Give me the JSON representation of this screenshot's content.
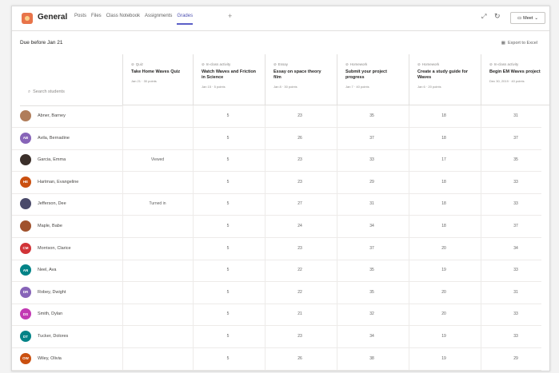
{
  "header": {
    "channel": "General",
    "tabs": [
      "Posts",
      "Files",
      "Class Notebook",
      "Assignments",
      "Grades"
    ],
    "active_tab": "Grades",
    "add_tab": "+",
    "meet_label": "Meet"
  },
  "toolbar": {
    "due_label": "Due before Jan 21",
    "export_label": "Export to Excel"
  },
  "search": {
    "placeholder": "Search students"
  },
  "columns": [
    {
      "type": "Quiz",
      "title": "Take Home Waves Quiz",
      "meta": "Jan 21 · 30 points"
    },
    {
      "type": "In-class activity",
      "title": "Watch Waves and Friction in Science",
      "meta": "Jan 15 · 5 points"
    },
    {
      "type": "Essay",
      "title": "Essay on space theory film",
      "meta": "Jan 8 · 30 points"
    },
    {
      "type": "Homework",
      "title": "Submit your project progress",
      "meta": "Jan 7 · 40 points"
    },
    {
      "type": "Homework",
      "title": "Create a study guide for Waves",
      "meta": "Jan 6 · 20 points"
    },
    {
      "type": "In-class activity",
      "title": "Begin EM Waves project",
      "meta": "Dec 30, 2019 · 40 points"
    }
  ],
  "students": [
    {
      "name": "Abner, Barney",
      "initials": "",
      "color": "#b07d5a",
      "cells": [
        "",
        "5",
        "23",
        "35",
        "18",
        "31"
      ]
    },
    {
      "name": "Avila, Bernadine",
      "initials": "AB",
      "color": "#8764b8",
      "cells": [
        "",
        "5",
        "26",
        "37",
        "18",
        "37"
      ]
    },
    {
      "name": "Garcia, Emma",
      "initials": "",
      "color": "#3b2f2a",
      "cells": [
        "Viewed",
        "5",
        "23",
        "33",
        "17",
        "35"
      ]
    },
    {
      "name": "Hartman, Evangeline",
      "initials": "HE",
      "color": "#ca5010",
      "cells": [
        "",
        "5",
        "23",
        "29",
        "18",
        "33"
      ]
    },
    {
      "name": "Jefferson, Dee",
      "initials": "",
      "color": "#4a4a6a",
      "cells": [
        "Turned in",
        "5",
        "27",
        "31",
        "18",
        "33"
      ]
    },
    {
      "name": "Maple, Babe",
      "initials": "",
      "color": "#a0522d",
      "cells": [
        "",
        "5",
        "24",
        "34",
        "18",
        "37"
      ]
    },
    {
      "name": "Morrison, Clarice",
      "initials": "CM",
      "color": "#d13438",
      "cells": [
        "",
        "5",
        "23",
        "37",
        "20",
        "34"
      ]
    },
    {
      "name": "Neel, Ava",
      "initials": "AN",
      "color": "#038387",
      "cells": [
        "",
        "5",
        "22",
        "35",
        "19",
        "33"
      ]
    },
    {
      "name": "Robey, Dwight",
      "initials": "DR",
      "color": "#8764b8",
      "cells": [
        "",
        "5",
        "22",
        "35",
        "20",
        "31"
      ]
    },
    {
      "name": "Smith, Dylan",
      "initials": "DS",
      "color": "#c239b3",
      "cells": [
        "",
        "5",
        "21",
        "32",
        "20",
        "33"
      ]
    },
    {
      "name": "Tucker, Dolores",
      "initials": "DT",
      "color": "#038387",
      "cells": [
        "",
        "5",
        "23",
        "34",
        "19",
        "33"
      ]
    },
    {
      "name": "Wiley, Olivia",
      "initials": "OW",
      "color": "#ca5010",
      "cells": [
        "",
        "5",
        "26",
        "38",
        "19",
        "29"
      ]
    }
  ],
  "icons": {
    "expand": "expand-icon",
    "refresh": "refresh-icon",
    "video": "video-icon",
    "chevron": "chevron-down-icon",
    "excel": "excel-icon",
    "search": "search-icon",
    "assignment": "assignment-icon"
  },
  "colors": {
    "accent": "#5b5fc7"
  }
}
